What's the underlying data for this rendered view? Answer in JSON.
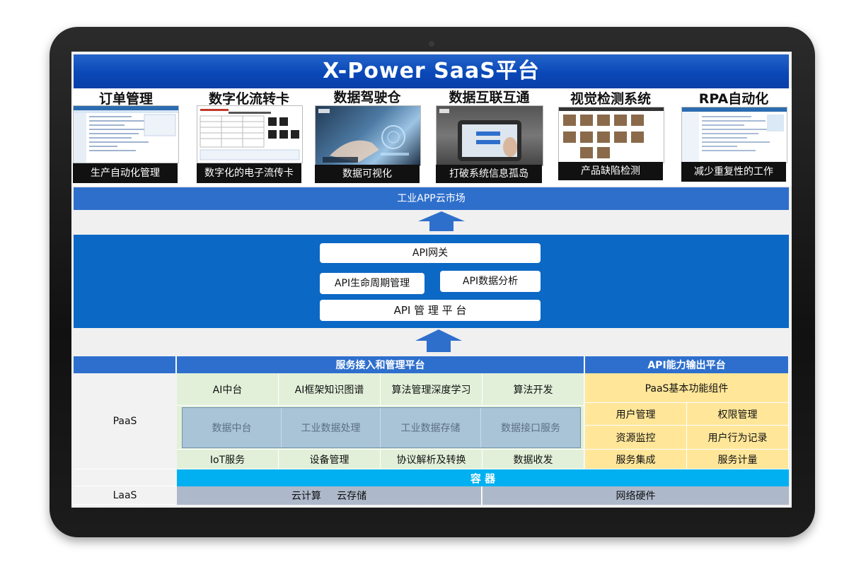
{
  "header": {
    "title": "X-Power  SaaS平台"
  },
  "apps": [
    {
      "title": "订单管理",
      "caption": "生产自动化管理"
    },
    {
      "title": "数字化流转卡",
      "caption": "数字化的电子流传卡"
    },
    {
      "title": "数据驾驶仓",
      "caption": "数据可视化"
    },
    {
      "title": "数据互联互通",
      "caption": "打破系统信息孤岛"
    },
    {
      "title": "视觉检测系统",
      "caption": "产品缺陷检测"
    },
    {
      "title": "RPA自动化",
      "caption": "减少重复性的工作"
    }
  ],
  "market": {
    "label": "工业APP云市场"
  },
  "api_platform": {
    "gateway": "API网关",
    "lifecycle": "API生命周期管理",
    "analysis": "API数据分析",
    "platform": "API 管 理 平 台"
  },
  "layers": {
    "service_header": "服务接入和管理平台",
    "output_header": "API能力输出平台",
    "paas": "PaaS",
    "laas": "LaaS",
    "row1": [
      "AI中台",
      "AI框架知识图谱",
      "算法管理深度学习",
      "算法开发"
    ],
    "data_row": [
      "数据中台",
      "工业数据处理",
      "工业数据存储",
      "数据接口服务"
    ],
    "row3": [
      "IoT服务",
      "设备管理",
      "协议解析及转换",
      "数据收发"
    ],
    "output": {
      "title": "PaaS基本功能组件",
      "items": [
        "用户管理",
        "权限管理",
        "资源监控",
        "用户行为记录",
        "服务集成",
        "服务计量"
      ]
    },
    "container": "容  器",
    "laas_left": "云计算     云存储",
    "laas_right": "网络硬件"
  },
  "colors": {
    "header_blue": "#0a48b8",
    "api_blue": "#0c68c5",
    "band_blue": "#2f6fcc",
    "green": "#e2f0d9",
    "yellow": "#ffe699",
    "container_cyan": "#00b0f0",
    "laas_gray": "#adb9ca"
  }
}
